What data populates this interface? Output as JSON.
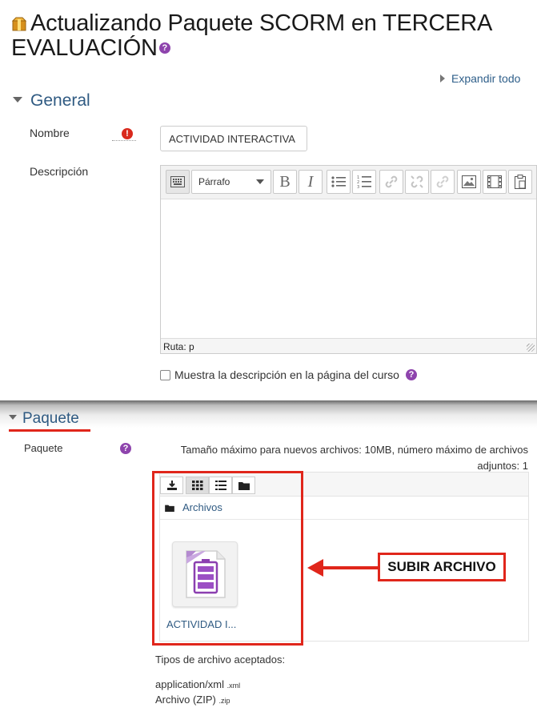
{
  "page": {
    "title": "Actualizando Paquete SCORM en TERCERA EVALUACIÓN",
    "expand_all": "Expandir todo"
  },
  "general": {
    "heading": "General",
    "nombre_label": "Nombre",
    "nombre_value": "ACTIVIDAD INTERACTIVA",
    "descripcion_label": "Descripción",
    "editor": {
      "format_select": "Párrafo",
      "path": "Ruta: p"
    },
    "show_description_label": "Muestra la descripción en la página del curso"
  },
  "paquete": {
    "heading": "Paquete",
    "label": "Paquete",
    "max_size_text": "Tamaño máximo para nuevos archivos: 10MB, número máximo de archivos adjuntos: 1",
    "filemanager": {
      "path": "Archivos",
      "file_name": "ACTIVIDAD I..."
    },
    "annotation_label": "SUBIR ARCHIVO",
    "accepted_title": "Tipos de archivo aceptados:",
    "accepted_types": [
      {
        "name": "application/xml",
        "ext": ".xml"
      },
      {
        "name": "Archivo (ZIP)",
        "ext": ".zip"
      }
    ]
  },
  "colors": {
    "accent_blue": "#2f5a82",
    "annotation_red": "#e0261b",
    "help_purple": "#8e44ad"
  }
}
